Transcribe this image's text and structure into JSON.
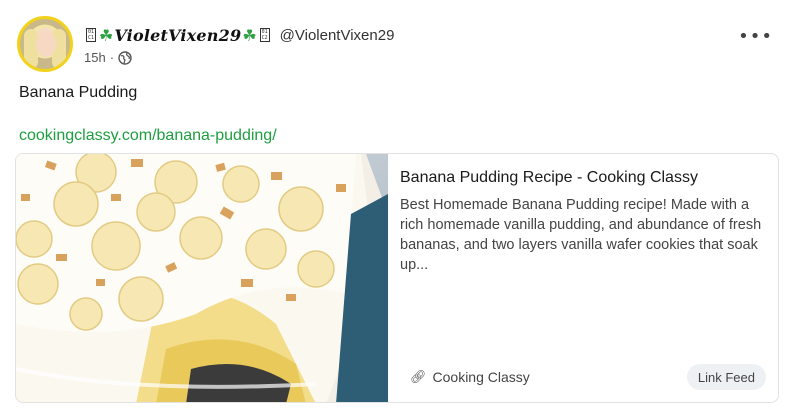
{
  "user": {
    "display_name": "VioletVixen29",
    "handle": "@ViolentVixen29",
    "time_ago": "15h",
    "separator": "·",
    "avatar_icon": "avatar-photo"
  },
  "post": {
    "text": "Banana Pudding",
    "link": "cookingclassy.com/banana-pudding/",
    "more_label": "•••"
  },
  "card": {
    "title": "Banana Pudding Recipe - Cooking Classy",
    "description": "Best Homemade Banana Pudding recipe! Made with a rich homemade vanilla pudding, and abundance of fresh bananas, and two layers vanilla wafer cookies that soak up...",
    "source": "Cooking Classy",
    "link_feed_label": "Link Feed",
    "image_icon": "banana-pudding-photo"
  },
  "colors": {
    "link_green": "#1e9e3e",
    "clover_green": "#2ea043",
    "avatar_ring": "#f2d21a"
  }
}
